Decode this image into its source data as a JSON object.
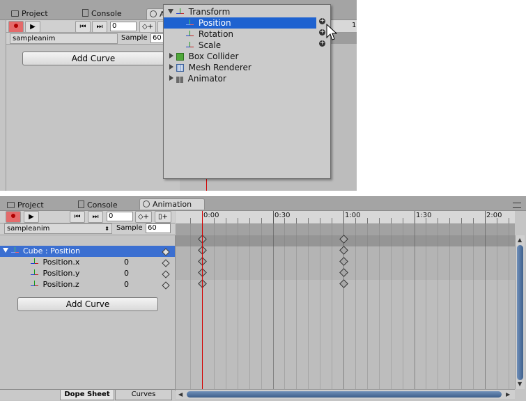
{
  "tabs": {
    "project": "Project",
    "console": "Console",
    "animation": "Animation",
    "animation_truncated": "A"
  },
  "toolbar": {
    "frame_value": "0",
    "sample_label": "Sample",
    "sample_value": "60",
    "record_icon": "record-dot-icon",
    "play_icon": "play-icon",
    "prev_key_icon": "prev-keyframe-icon",
    "next_key_icon": "next-keyframe-icon",
    "add_key_icon": "add-keyframe-icon",
    "add_event_icon": "add-event-icon"
  },
  "clip": {
    "name": "sampleanim"
  },
  "add_curve_label": "Add Curve",
  "popup": {
    "items": [
      {
        "label": "Transform",
        "expanded": true,
        "icon": "transform-axis-icon"
      },
      {
        "label": "Position",
        "selected": true,
        "icon": "transform-axis-icon"
      },
      {
        "label": "Rotation",
        "icon": "transform-axis-icon"
      },
      {
        "label": "Scale",
        "icon": "transform-axis-icon"
      },
      {
        "label": "Box Collider",
        "expanded": false,
        "icon": "box-collider-icon"
      },
      {
        "label": "Mesh Renderer",
        "expanded": false,
        "icon": "mesh-renderer-icon"
      },
      {
        "label": "Animator",
        "expanded": false,
        "icon": "animator-icon"
      }
    ],
    "ruler_fragment": "1"
  },
  "properties": {
    "group_label": "Cube : Position",
    "rows": [
      {
        "label": "Position.x",
        "value": "0"
      },
      {
        "label": "Position.y",
        "value": "0"
      },
      {
        "label": "Position.z",
        "value": "0"
      }
    ]
  },
  "timeline": {
    "ticks": [
      "0:00",
      "0:30",
      "1:00",
      "1:30",
      "2:00"
    ],
    "keyframes_seconds": [
      0,
      60
    ]
  },
  "view_tabs": {
    "dope_sheet": "Dope Sheet",
    "curves": "Curves"
  },
  "colors": {
    "selection": "#3b6fd1",
    "popup_selection": "#1e62d0",
    "record": "#e46a6a",
    "playhead": "#d40000",
    "scroll_thumb": "#4f74a8"
  }
}
